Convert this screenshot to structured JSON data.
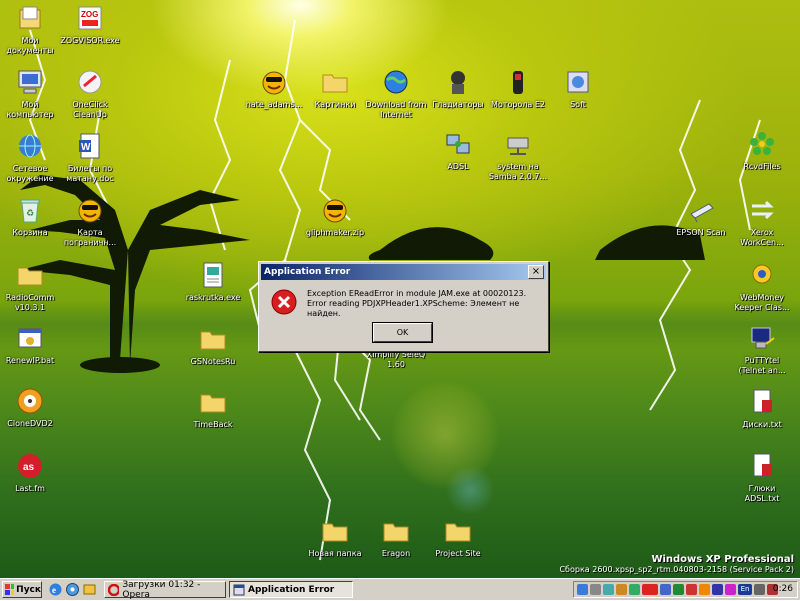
{
  "desktop_icons": [
    {
      "label": "Мои\nдокументы",
      "icon": "my-documents-icon"
    },
    {
      "label": "ZOGVISOR.exe",
      "icon": "zog-app-icon"
    },
    {
      "label": "Мой\nкомпьютер",
      "icon": "my-computer-icon"
    },
    {
      "label": "OneClick\nCleanUp",
      "icon": "cleanup-icon"
    },
    {
      "label": "Сетевое\nокружение",
      "icon": "network-icon"
    },
    {
      "label": "Билеты по\nматану.doc",
      "icon": "word-doc-icon"
    },
    {
      "label": "Корзина",
      "icon": "recycle-bin-icon"
    },
    {
      "label": "Карта\nпограничн...",
      "icon": "smiley-icon"
    },
    {
      "label": "RadioComm\nv10.3.1",
      "icon": "folder-icon"
    },
    {
      "label": "raskrutka.exe",
      "icon": "exe-icon"
    },
    {
      "label": "RenewIP.bat",
      "icon": "bat-icon"
    },
    {
      "label": "GSNotesRu",
      "icon": "folder-icon"
    },
    {
      "label": "CloneDVD2",
      "icon": "clonedvd-icon"
    },
    {
      "label": "TimeBack",
      "icon": "folder-icon"
    },
    {
      "label": "Last.fm",
      "icon": "lastfm-icon"
    },
    {
      "label": "nate_adams...",
      "icon": "smiley-icon"
    },
    {
      "label": "Картинки",
      "icon": "folder-icon"
    },
    {
      "label": "Download from\nInternet",
      "icon": "globe-icon"
    },
    {
      "label": "Гладиаторы",
      "icon": "gladiator-icon"
    },
    {
      "label": "Моторола E2",
      "icon": "phone-icon"
    },
    {
      "label": "Soft",
      "icon": "soft-icon"
    },
    {
      "label": "ADSL",
      "icon": "network-connection-icon"
    },
    {
      "label": "system на\nSamba 2.0.7...",
      "icon": "network-drive-icon"
    },
    {
      "label": "gliphmaker.zip",
      "icon": "smiley-icon"
    },
    {
      "label": "Ximplify SeleQ\n1.60",
      "icon": "app-icon"
    },
    {
      "label": "RcvdFiles",
      "icon": "icq-flower-icon"
    },
    {
      "label": "EPSON Scan",
      "icon": "scanner-icon"
    },
    {
      "label": "Xerox\nWorkCen...",
      "icon": "xerox-icon"
    },
    {
      "label": "WebMoney\nKeeper Clas...",
      "icon": "webmoney-icon"
    },
    {
      "label": "PuTTYtel\n(Telnet an...",
      "icon": "putty-icon"
    },
    {
      "label": "Диски.txt",
      "icon": "txt-icon"
    },
    {
      "label": "Глюки\nADSL.txt",
      "icon": "txt-icon"
    },
    {
      "label": "Новая папка",
      "icon": "folder-icon"
    },
    {
      "label": "Eragon",
      "icon": "folder-icon"
    },
    {
      "label": "Project Site",
      "icon": "folder-icon"
    }
  ],
  "dialog": {
    "title": "Application Error",
    "close_label": "×",
    "message_line1": "Exception EReadError in module JAM.exe at 00020123.",
    "message_line2": "Error reading PDJXPHeader1.XPScheme: Элемент не найден.",
    "ok_label": "OK",
    "icon": "error-icon"
  },
  "watermark": {
    "line1": "Windows XP Professional",
    "line2": "Сборка 2600.xpsp_sp2_rtm.040803-2158 (Service Pack 2)"
  },
  "taskbar": {
    "start_label": "Пуск",
    "quick_launch": [
      "ie-icon",
      "explorer-icon",
      "show-desktop-icon"
    ],
    "buttons": [
      {
        "label": "Загрузки 01:32 - Opera",
        "icon": "opera-icon",
        "active": false
      },
      {
        "label": "Application Error",
        "icon": "app-error-icon",
        "active": true
      }
    ],
    "tray_icons": [
      "network-tray-icon",
      "volume-tray-icon",
      "app-tray-icon",
      "antivirus-tray-icon",
      "monitor-tray-icon",
      "speed-tray-icon",
      "app2-tray-icon",
      "lang-tray-icon",
      "app3-tray-icon",
      "app4-tray-icon",
      "app5-tray-icon",
      "app6-tray-icon",
      "keyboard-tray-icon",
      "lang-en-tray-icon",
      "shield-tray-icon"
    ],
    "lang_label": "En",
    "clock": "0:26"
  }
}
